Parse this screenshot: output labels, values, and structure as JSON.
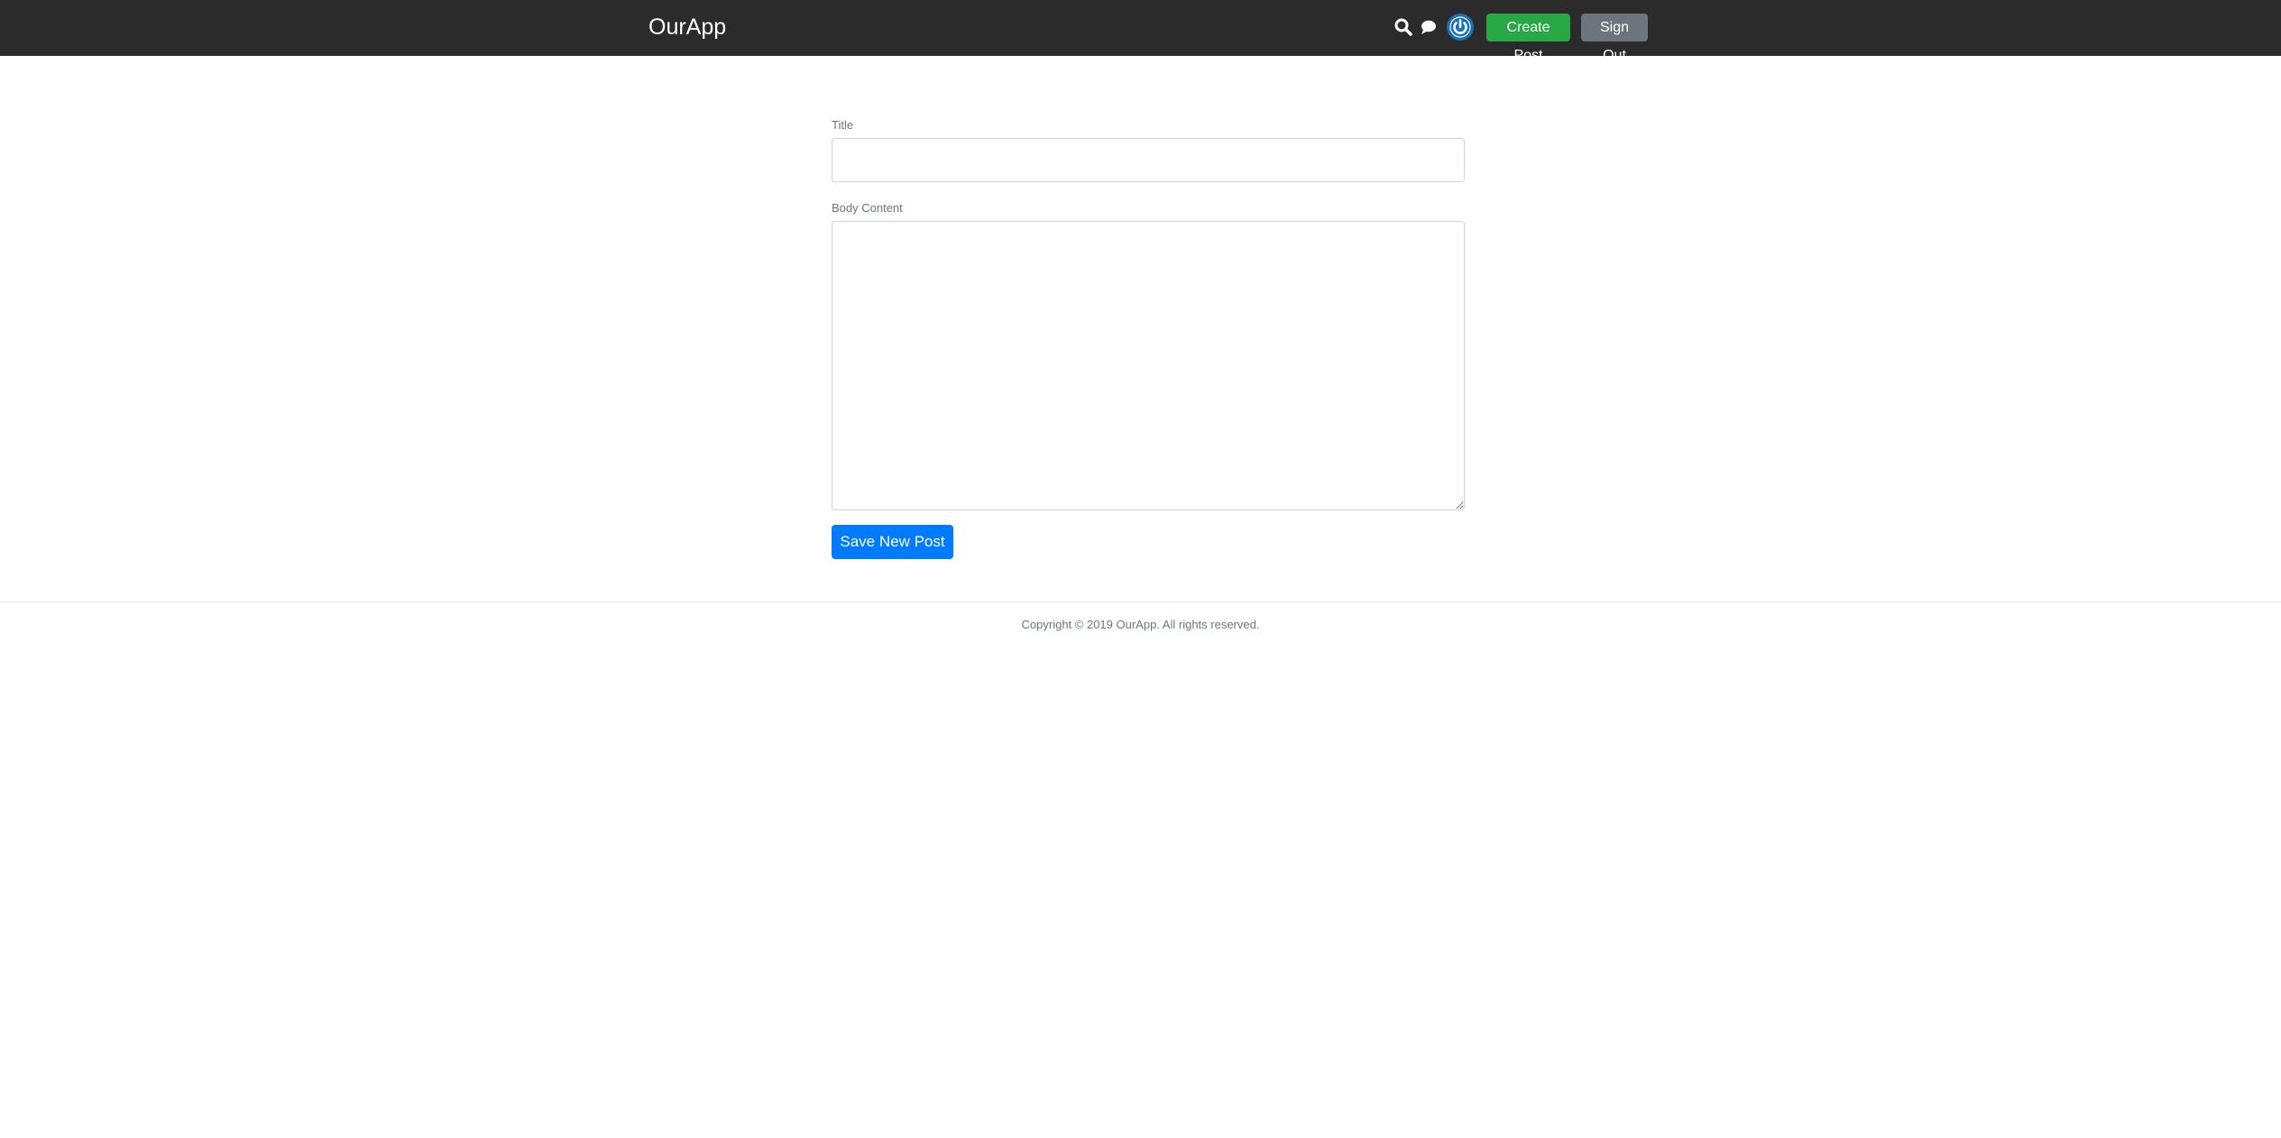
{
  "header": {
    "brand": "OurApp",
    "icons": [
      "search-icon",
      "chat-icon"
    ],
    "avatar_icon": "power-avatar-icon",
    "create_post_label": "Create Post",
    "sign_out_label": "Sign Out",
    "colors": {
      "bar": "#2b2b2b",
      "create_post": "#28a745",
      "sign_out": "#6c757d",
      "avatar": "#1a6fb5"
    }
  },
  "form": {
    "title_label": "Title",
    "title_value": "",
    "body_label": "Body Content",
    "body_value": "",
    "save_label": "Save New Post",
    "save_color": "#007bff"
  },
  "footer": {
    "copyright": "Copyright © 2019 OurApp. All rights reserved."
  }
}
